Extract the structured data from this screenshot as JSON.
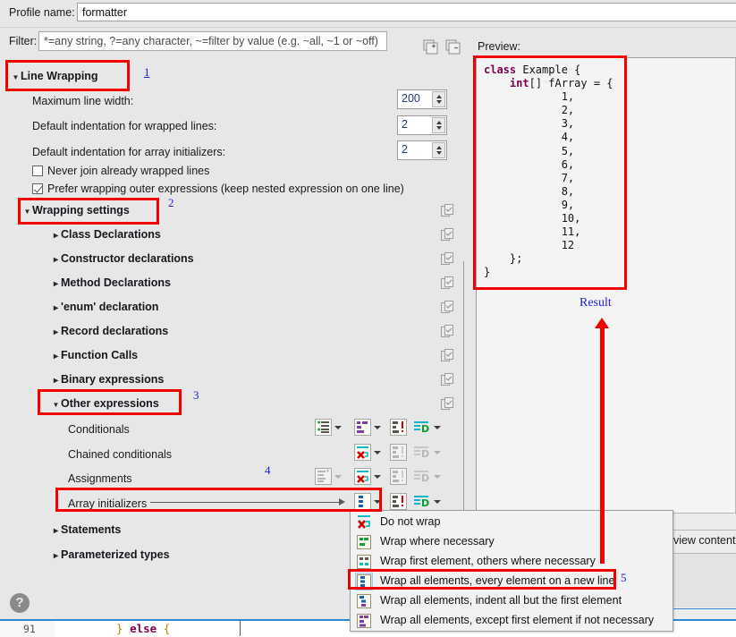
{
  "profile": {
    "label": "Profile name:",
    "value": "formatter"
  },
  "filter": {
    "label": "Filter:",
    "placeholder": "*=any string, ?=any character, ~=filter by value (e.g. ~all, ~1 or ~off)",
    "value": "",
    "expand_all_icon": "expand-all-icon",
    "collapse_all_icon": "collapse-all-icon"
  },
  "line_wrapping": {
    "title": "Line Wrapping",
    "expanded": true,
    "fields": [
      {
        "label": "Maximum line width:",
        "value": "200"
      },
      {
        "label": "Default indentation for wrapped lines:",
        "value": "2"
      },
      {
        "label": "Default indentation for array initializers:",
        "value": "2"
      }
    ],
    "checkboxes": [
      {
        "label": "Never join already wrapped lines",
        "checked": false
      },
      {
        "label": "Prefer wrapping outer expressions (keep nested expression on one line)",
        "checked": true
      }
    ]
  },
  "wrapping_settings": {
    "title": "Wrapping settings",
    "expanded": true,
    "nodes": [
      {
        "label": "Class Declarations",
        "expanded": false
      },
      {
        "label": "Constructor declarations",
        "expanded": false
      },
      {
        "label": "Method Declarations",
        "expanded": false
      },
      {
        "label": "'enum' declaration",
        "expanded": false
      },
      {
        "label": "Record declarations",
        "expanded": false
      },
      {
        "label": "Function Calls",
        "expanded": false
      },
      {
        "label": "Binary expressions",
        "expanded": false
      }
    ],
    "other_expressions": {
      "label": "Other expressions",
      "expanded": true,
      "rows": [
        {
          "label": "Conditionals",
          "wrap_icon": "wrap-indent-icon",
          "style_icon": "wrap-where-necessary-icon",
          "force_icon": "force-split-icon",
          "default_icon": "default-d-icon",
          "enabled": true
        },
        {
          "label": "Chained conditionals",
          "wrap_icon": null,
          "style_icon": "do-not-wrap-icon",
          "force_icon": "force-split-icon",
          "default_icon": "default-d-icon",
          "enabled": false
        },
        {
          "label": "Assignments",
          "wrap_icon": "indent-policy-icon",
          "style_icon": "do-not-wrap-icon",
          "force_icon": "force-split-icon",
          "default_icon": "default-d-icon",
          "enabled": false
        },
        {
          "label": "Array initializers",
          "wrap_icon": null,
          "style_icon": "wrap-all-new-line-icon",
          "force_icon": "force-split-icon",
          "default_icon": "default-d-icon",
          "enabled": true
        }
      ]
    },
    "trailing_nodes": [
      {
        "label": "Statements",
        "expanded": false
      },
      {
        "label": "Parameterized types",
        "expanded": false
      }
    ]
  },
  "dropdown_menu": {
    "items": [
      {
        "label": "Do not wrap",
        "icon": "do-not-wrap-icon",
        "selected": false
      },
      {
        "label": "Wrap where necessary",
        "icon": "wrap-where-necessary-icon",
        "selected": false
      },
      {
        "label": "Wrap first element, others where necessary",
        "icon": "wrap-first-element-icon",
        "selected": false
      },
      {
        "label": "Wrap all elements, every element on a new line",
        "icon": "wrap-all-new-line-icon",
        "selected": true
      },
      {
        "label": "Wrap all elements, indent all but the first element",
        "icon": "wrap-all-indent-icon",
        "selected": false
      },
      {
        "label": "Wrap all elements, except first element if not necessary",
        "icon": "wrap-all-except-first-icon",
        "selected": false
      }
    ]
  },
  "preview": {
    "label": "Preview:",
    "code_lines": [
      "class Example {",
      "    int[] fArray = {",
      "            1,",
      "            2,",
      "            3,",
      "            4,",
      "            5,",
      "            6,",
      "            7,",
      "            8,",
      "            9,",
      "            10,",
      "            11,",
      "            12",
      "    };",
      "}"
    ],
    "keywords": [
      "class",
      "int"
    ]
  },
  "bottom_right_panel": {
    "text": "eview content"
  },
  "editor_strip": {
    "line_number": "91",
    "code": "} else {"
  },
  "help": {
    "icon": "help-icon",
    "glyph": "?"
  },
  "annotations": {
    "result_label": "Result",
    "numbers": [
      "1",
      "2",
      "3",
      "4",
      "5"
    ],
    "color": "#f20000",
    "number_color": "#2222dd"
  }
}
